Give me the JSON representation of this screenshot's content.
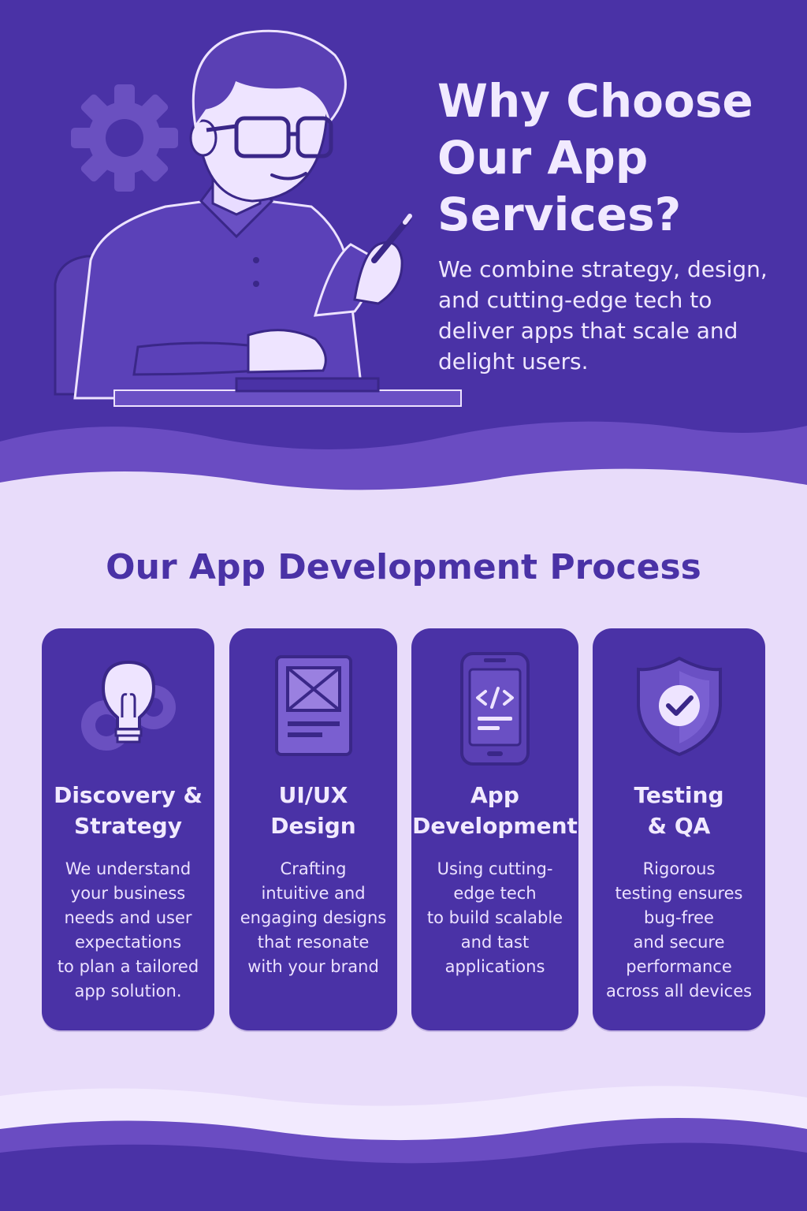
{
  "hero": {
    "title": "Why Choose\nOur App\nServices?",
    "text": "We combine strategy, design, and cutting-edge tech to deliver apps that scale and delight users."
  },
  "process": {
    "title": "Our App Development Process",
    "steps": [
      {
        "title": "Discovery &\nStrategy",
        "text": "We understand\nyour business\nneeds and user\nexpectations\nto plan a tailored\napp solution.",
        "icon": "lightbulb-gear-icon"
      },
      {
        "title": "UI/UX\nDesign",
        "text": "Crafting\nintuitive and\nengaging designs\nthat resonate\nwith your brand",
        "icon": "wireframe-icon"
      },
      {
        "title": "App\nDevelopment",
        "text": "Using cutting-\nedge tech\nto build scalable\nand tast\napplications",
        "icon": "phone-code-icon"
      },
      {
        "title": "Testing\n& QA",
        "text": "Rigorous\ntesting ensures\nbug-free\nand secure\nperformance\nacross all devices",
        "icon": "shield-check-icon"
      }
    ]
  },
  "colors": {
    "primary": "#4a32a6",
    "light": "#e8dcfa",
    "wave": "#6a4cc2",
    "text_light": "#f1eaff"
  }
}
